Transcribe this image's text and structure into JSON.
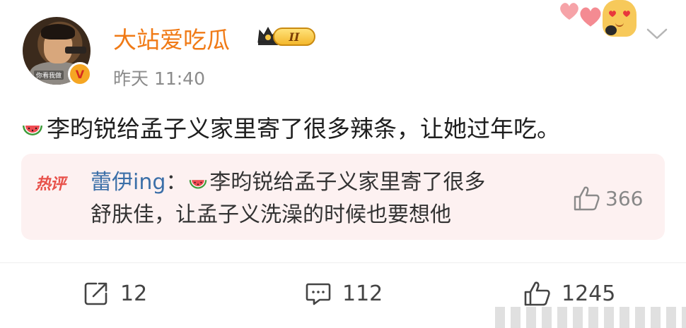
{
  "author": {
    "name": "大站爱吃瓜",
    "level_badge": "II",
    "timestamp": "昨天 11:40",
    "avatar_watermark": "你看我做",
    "verified_mark": "V"
  },
  "post": {
    "emoji": "watermelon-icon",
    "text": "李昀锐给孟子义家里寄了很多辣条，让她过年吃。"
  },
  "hot_comment": {
    "tag": "热评",
    "username": "蕾伊ing",
    "separator": "：",
    "emoji": "watermelon-icon",
    "text_line1": "李昀锐给孟子义家里寄了很多",
    "text_line2": "舒肤佳，让孟子义洗澡的时候也要想他",
    "likes": "366"
  },
  "actions": {
    "repost_count": "12",
    "comment_count": "112",
    "like_count": "1245"
  },
  "colors": {
    "username": "#f07a16",
    "hot_tag": "#e8514a",
    "hot_name": "#3b6fa8",
    "hot_bg": "#fdf1f1",
    "timestamp": "#8b8b8b"
  }
}
